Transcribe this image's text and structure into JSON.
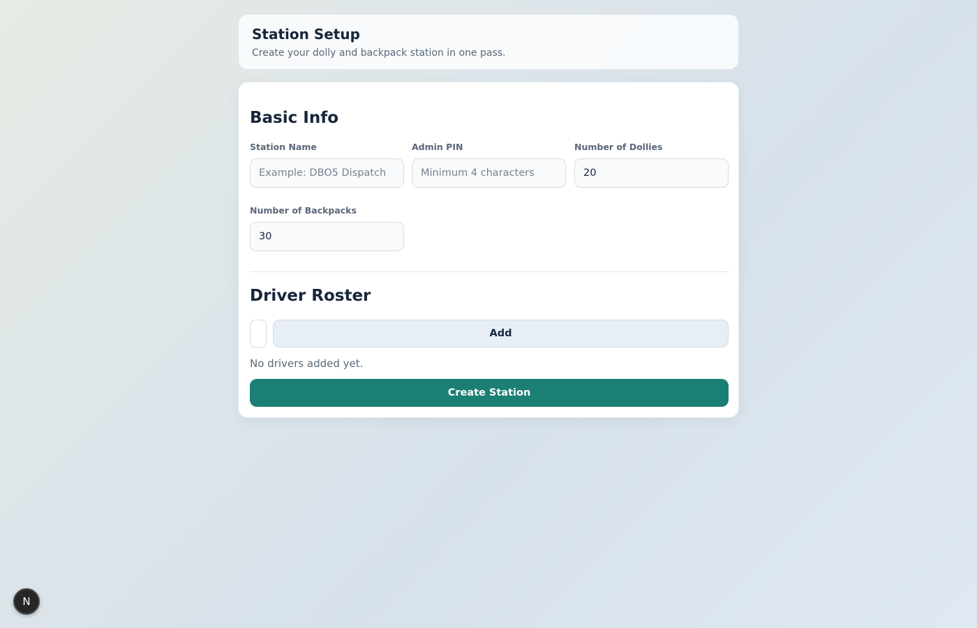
{
  "header": {
    "title": "Station Setup",
    "subtitle": "Create your dolly and backpack station in one pass."
  },
  "basic_info": {
    "title": "Basic Info",
    "station_name": {
      "label": "Station Name",
      "placeholder": "Example: DBO5 Dispatch",
      "value": ""
    },
    "admin_pin": {
      "label": "Admin PIN",
      "placeholder": "Minimum 4 characters",
      "value": ""
    },
    "dollies": {
      "label": "Number of Dollies",
      "value": "20"
    },
    "backpacks": {
      "label": "Number of Backpacks",
      "value": "30"
    }
  },
  "driver_roster": {
    "title": "Driver Roster",
    "add_label": "Add",
    "empty_text": "No drivers added yet."
  },
  "create_label": "Create Station",
  "badge_letter": "N",
  "colors": {
    "primary": "#1b8073",
    "add_button_bg": "#e8eef6",
    "text_dark": "#16263a",
    "text_muted": "#5a6878"
  }
}
